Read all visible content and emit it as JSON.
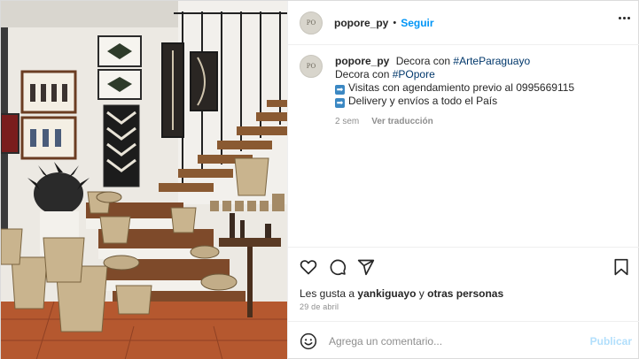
{
  "header": {
    "username": "popore_py",
    "separator": "•",
    "follow_label": "Seguir",
    "avatar_text": "PO"
  },
  "caption": {
    "username": "popore_py",
    "line1_text": "Decora con",
    "line1_hashtag": "#ArteParaguayo",
    "line2_text": "Decora con",
    "line2_hashtag": "#POpore",
    "line3_arrow": "➡",
    "line3_text": "Visitas con agendamiento previo al 0995669115",
    "line4_arrow": "➡",
    "line4_text": "Delivery y envíos a todo el País",
    "time": "2 sem",
    "translate_label": "Ver traducción"
  },
  "actions": {
    "like_icon": "heart-icon",
    "comment_icon": "comment-icon",
    "share_icon": "share-icon",
    "save_icon": "bookmark-icon"
  },
  "likes": {
    "prefix": "Les gusta a",
    "user": "yankiguayo",
    "connector": "y",
    "others": "otras personas"
  },
  "date": "29 de abril",
  "comment_box": {
    "placeholder": "Agrega un comentario...",
    "post_label": "Publicar"
  },
  "colors": {
    "accent": "#0095f6",
    "hashtag": "#00376b",
    "muted": "#8e8e8e",
    "post_disabled": "#b2dffc"
  }
}
